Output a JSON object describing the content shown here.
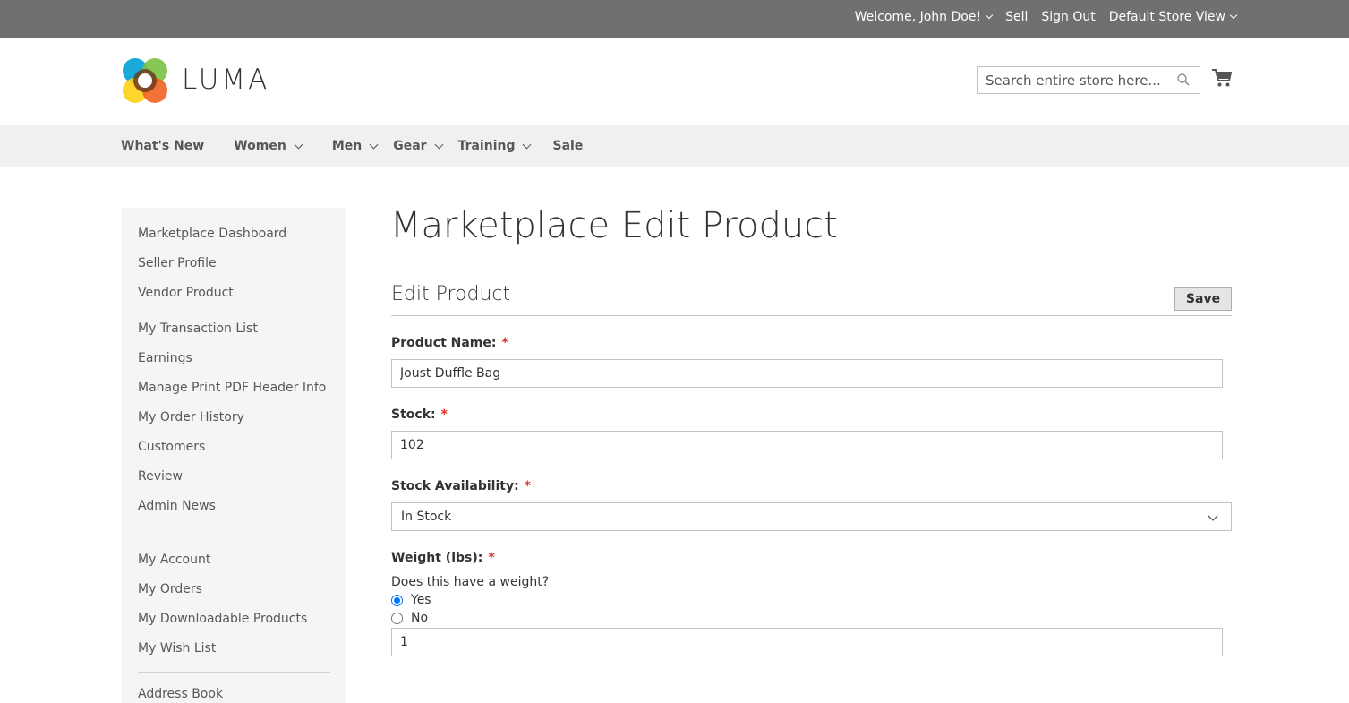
{
  "topbar": {
    "welcome": "Welcome, John Doe!",
    "sell": "Sell",
    "sign_out": "Sign Out",
    "store_view": "Default Store View"
  },
  "header": {
    "logo_text": "LUMA",
    "search_placeholder": "Search entire store here..."
  },
  "nav": {
    "items": [
      "What's New",
      "Women",
      "Men",
      "Gear",
      "Training",
      "Sale"
    ]
  },
  "sidebar": {
    "items": [
      "Marketplace Dashboard",
      "Seller Profile",
      "Vendor Product",
      "My Transaction List",
      "Earnings",
      "Manage Print PDF Header Info",
      "My Order History",
      "Customers",
      "Review",
      "Admin News",
      "My Account",
      "My Orders",
      "My Downloadable Products",
      "My Wish List",
      "Address Book"
    ]
  },
  "main": {
    "page_title": "Marketplace Edit Product",
    "section_title": "Edit Product",
    "save_label": "Save",
    "product_name_label": "Product Name:",
    "product_name_value": "Joust Duffle Bag",
    "stock_label": "Stock:",
    "stock_value": "102",
    "stock_availability_label": "Stock Availability:",
    "stock_availability_value": "In Stock",
    "weight_label": "Weight (lbs):",
    "weight_question": "Does this have a weight?",
    "weight_yes": "Yes",
    "weight_no": "No",
    "weight_value": "1",
    "required_mark": "*"
  },
  "colors": {
    "topbar_bg": "#6e716e",
    "nav_bg": "#f0f0f0",
    "sidebar_bg": "#f5f5f5",
    "required": "#e02b27",
    "radio_accent": "#0075ff"
  }
}
